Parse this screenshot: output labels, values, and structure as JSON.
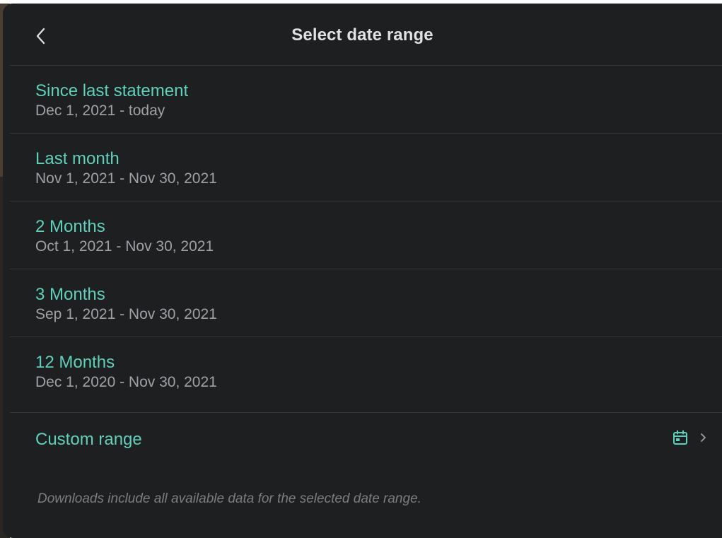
{
  "header": {
    "title": "Select date range"
  },
  "options": [
    {
      "label": "Since last statement",
      "range": "Dec 1, 2021 - today"
    },
    {
      "label": "Last month",
      "range": "Nov 1, 2021 - Nov 30, 2021"
    },
    {
      "label": "2 Months",
      "range": "Oct 1, 2021 - Nov 30, 2021"
    },
    {
      "label": "3 Months",
      "range": "Sep 1, 2021 - Nov 30, 2021"
    },
    {
      "label": "12 Months",
      "range": "Dec 1, 2020 - Nov 30, 2021"
    }
  ],
  "custom": {
    "label": "Custom range",
    "icon": "calendar-icon"
  },
  "footnote": "Downloads include all available data for the selected date range.",
  "colors": {
    "panel_background": "#1e1f21",
    "accent": "#5fd0bb",
    "title_text": "#dfe1e4",
    "secondary_text": "#9ea1a6",
    "divider": "#34363a"
  }
}
